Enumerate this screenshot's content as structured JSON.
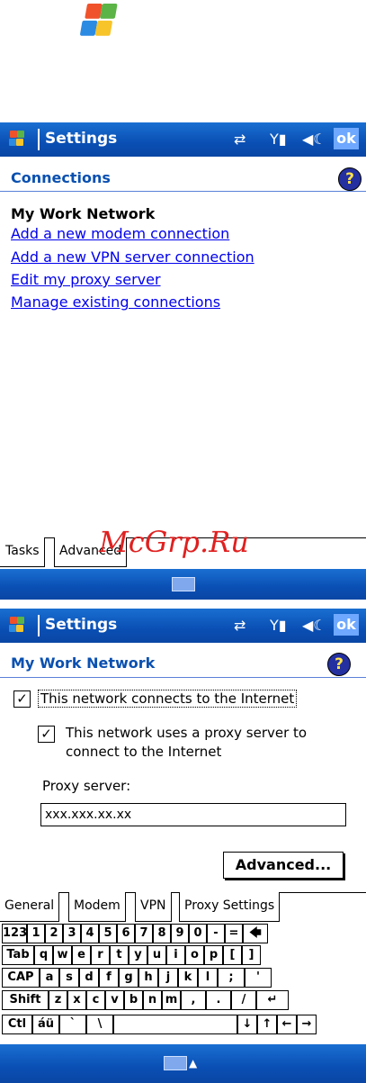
{
  "screen1": {
    "title": "Settings",
    "ok": "ok",
    "header": "Connections",
    "section": "My Work Network",
    "links": [
      "Add a new modem connection",
      "Add a new VPN server connection",
      "Edit my proxy server",
      "Manage existing connections"
    ],
    "tabs": [
      "Tasks",
      "Advanced"
    ]
  },
  "screen2": {
    "title": "Settings",
    "ok": "ok",
    "header": "My Work Network",
    "check1": {
      "label": "This network connects to the Internet",
      "checked": true
    },
    "check2": {
      "label_line1": "This network uses a proxy server to",
      "label_line2": "connect to the Internet",
      "checked": true
    },
    "proxy_label": "Proxy server:",
    "proxy_value": "xxx.xxx.xx.xx",
    "advanced_button": "Advanced...",
    "tabs": [
      "General",
      "Modem",
      "VPN",
      "Proxy Settings"
    ]
  },
  "keyboard": {
    "row1": [
      "123",
      "1",
      "2",
      "3",
      "4",
      "5",
      "6",
      "7",
      "8",
      "9",
      "0",
      "-",
      "=",
      "🡄"
    ],
    "row2": [
      "Tab",
      "q",
      "w",
      "e",
      "r",
      "t",
      "y",
      "u",
      "i",
      "o",
      "p",
      "[",
      "]"
    ],
    "row3": [
      "CAP",
      "a",
      "s",
      "d",
      "f",
      "g",
      "h",
      "j",
      "k",
      "l",
      ";",
      "'"
    ],
    "row4": [
      "Shift",
      "z",
      "x",
      "c",
      "v",
      "b",
      "n",
      "m",
      ",",
      ".",
      "/",
      "↵"
    ],
    "row5": [
      "Ctl",
      "áü",
      "`",
      "\\",
      "",
      "↓",
      "↑",
      "←",
      "→"
    ]
  },
  "watermark": "McGrp.Ru",
  "colors": {
    "titlebar": "#0a4fb4",
    "link": "#0000ee",
    "header": "#0a50b0"
  }
}
